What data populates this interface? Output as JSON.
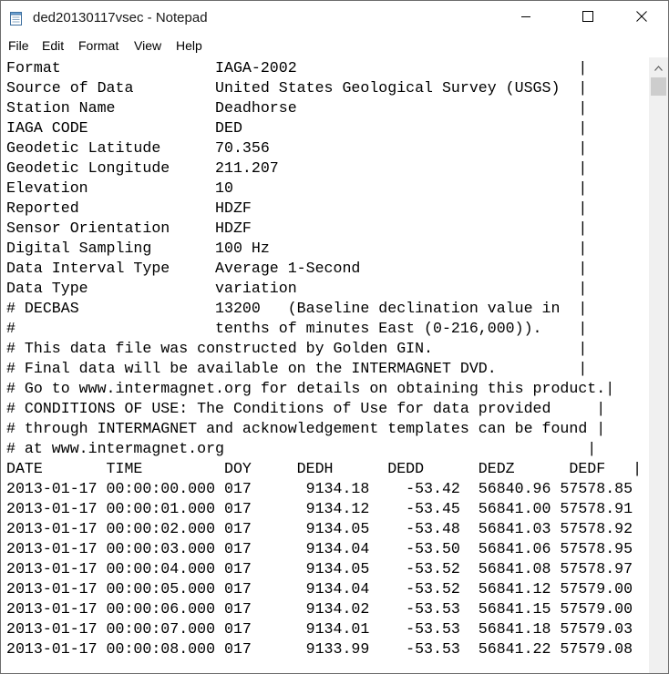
{
  "window": {
    "title": "ded20130117vsec - Notepad"
  },
  "menu": {
    "items": [
      "File",
      "Edit",
      "Format",
      "View",
      "Help"
    ]
  },
  "document": {
    "lines": [
      "Format                 IAGA-2002                               |",
      "Source of Data         United States Geological Survey (USGS)  |",
      "Station Name           Deadhorse                               |",
      "IAGA CODE              DED                                     |",
      "Geodetic Latitude      70.356                                  |",
      "Geodetic Longitude     211.207                                 |",
      "Elevation              10                                      |",
      "Reported               HDZF                                    |",
      "Sensor Orientation     HDZF                                    |",
      "Digital Sampling       100 Hz                                  |",
      "Data Interval Type     Average 1-Second                        |",
      "Data Type              variation                               |",
      "# DECBAS               13200   (Baseline declination value in  |",
      "#                      tenths of minutes East (0-216,000)).    |",
      "# This data file was constructed by Golden GIN.                |",
      "# Final data will be available on the INTERMAGNET DVD.         |",
      "# Go to www.intermagnet.org for details on obtaining this product.|",
      "# CONDITIONS OF USE: The Conditions of Use for data provided     |",
      "# through INTERMAGNET and acknowledgement templates can be found |",
      "# at www.intermagnet.org                                        |",
      "DATE       TIME         DOY     DEDH      DEDD      DEDZ      DEDF   |",
      "2013-01-17 00:00:00.000 017      9134.18    -53.42  56840.96 57578.85",
      "2013-01-17 00:00:01.000 017      9134.12    -53.45  56841.00 57578.91",
      "2013-01-17 00:00:02.000 017      9134.05    -53.48  56841.03 57578.92",
      "2013-01-17 00:00:03.000 017      9134.04    -53.50  56841.06 57578.95",
      "2013-01-17 00:00:04.000 017      9134.05    -53.52  56841.08 57578.97",
      "2013-01-17 00:00:05.000 017      9134.04    -53.52  56841.12 57579.00",
      "2013-01-17 00:00:06.000 017      9134.02    -53.53  56841.15 57579.00",
      "2013-01-17 00:00:07.000 017      9134.01    -53.53  56841.18 57579.03",
      "2013-01-17 00:00:08.000 017      9133.99    -53.53  56841.22 57579.08"
    ]
  },
  "icons": {
    "app": "notepad-icon",
    "minimize": "minimize-icon",
    "maximize": "maximize-icon",
    "close": "close-icon",
    "scroll_up": "scroll-up-arrow-icon"
  }
}
